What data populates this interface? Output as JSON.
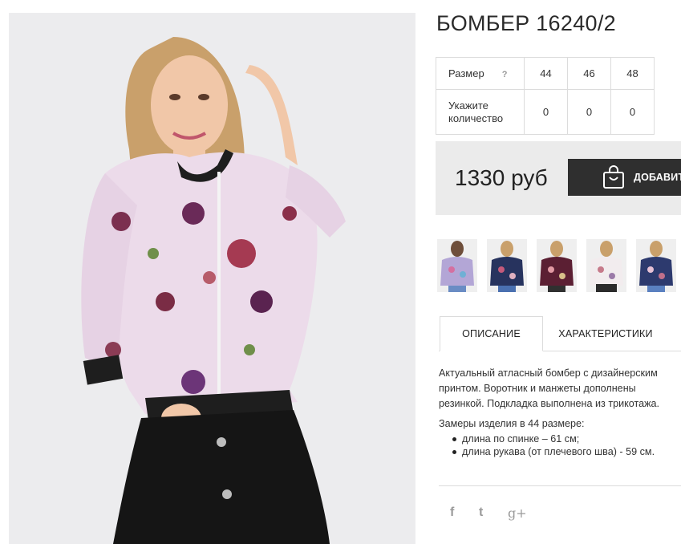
{
  "product": {
    "title": "БОМБЕР 16240/2",
    "price": "1330 руб",
    "add_button_label": "ДОБАВИТЬ"
  },
  "size_table": {
    "size_label": "Размер",
    "help_mark": "?",
    "sizes": [
      "44",
      "46",
      "48"
    ],
    "qty_label_line1": "Укажите",
    "qty_label_line2": "количество",
    "quantities": [
      "0",
      "0",
      "0"
    ]
  },
  "tabs": {
    "description": "ОПИСАНИЕ",
    "characteristics": "ХАРАКТЕРИСТИКИ"
  },
  "description": {
    "text": "Актуальный атласный бомбер с дизайнерским принтом. Воротник и манжеты дополнены резинкой. Подкладка выполнена из трикотажа.",
    "measure_title": "Замеры изделия в 44 размере:",
    "measures": [
      "длина по спинке – 61 см;",
      "длина рукава (от плечевого шва) - 59 см."
    ]
  },
  "social": {
    "facebook": "f",
    "twitter": "t",
    "gplus": "g+"
  },
  "icons": {
    "cart": "shopping-bag-icon",
    "facebook": "facebook-icon",
    "twitter": "twitter-icon",
    "gplus": "google-plus-icon"
  },
  "colors": {
    "button_bg": "#2f2f2f",
    "panel_bg": "#ebebeb",
    "border": "#dcdcdc",
    "social": "#9a9a9a"
  }
}
